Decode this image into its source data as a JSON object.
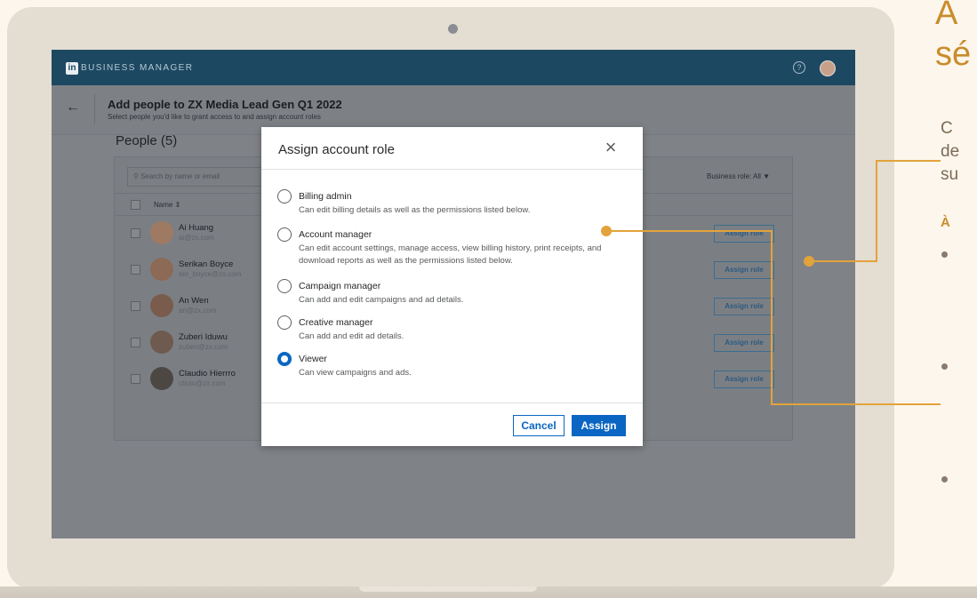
{
  "app": {
    "brand": "BUSINESS MANAGER",
    "logo_letters": "in"
  },
  "subheader": {
    "title": "Add people to ZX Media Lead Gen Q1 2022",
    "description": "Select people you'd like to grant access to and assign account roles"
  },
  "people": {
    "title": "People (5)",
    "search_placeholder": "Search by name or email",
    "business_role_filter": "Business role: All ▼",
    "column_name": "Name ⇕",
    "assign_label": "Assign role",
    "rows": [
      {
        "name": "Ai Huang",
        "email": "ai@zx.com"
      },
      {
        "name": "Serikan Boyce",
        "email": "ser_boyce@zx.com"
      },
      {
        "name": "An Wen",
        "email": "an@zx.com"
      },
      {
        "name": "Zuberi Iduwu",
        "email": "zuberi@zx.com"
      },
      {
        "name": "Claudio Hierrro",
        "email": "cbuio@zx.com"
      }
    ]
  },
  "modal": {
    "title": "Assign account role",
    "close_icon": "×",
    "options": [
      {
        "label": "Billing admin",
        "desc": "Can edit billing details as well as the permissions listed below.",
        "checked": false
      },
      {
        "label": "Account manager",
        "desc": "Can edit account settings, manage access, view billing history, print receipts, and download reports as well as the permissions listed below.",
        "checked": false
      },
      {
        "label": "Campaign manager",
        "desc": "Can add and edit campaigns and ad details.",
        "checked": false
      },
      {
        "label": "Creative manager",
        "desc": "Can add and edit ad details.",
        "checked": false
      },
      {
        "label": "Viewer",
        "desc": "Can view campaigns and ads.",
        "checked": true
      }
    ],
    "cancel_label": "Cancel",
    "assign_label": "Assign"
  },
  "side_panel": {
    "heading_line1": "A",
    "heading_line2": "sé",
    "text_line1": "C",
    "text_line2": "de",
    "text_line3": "su",
    "bold_label": "À"
  },
  "colors": {
    "accent_orange": "#e3a33b",
    "linkedin_blue": "#0a66c2",
    "header_navy": "#1d4862"
  },
  "icons": {
    "back": "arrow-left-icon",
    "help": "question-circle-icon",
    "search": "search-icon",
    "close": "close-icon"
  }
}
